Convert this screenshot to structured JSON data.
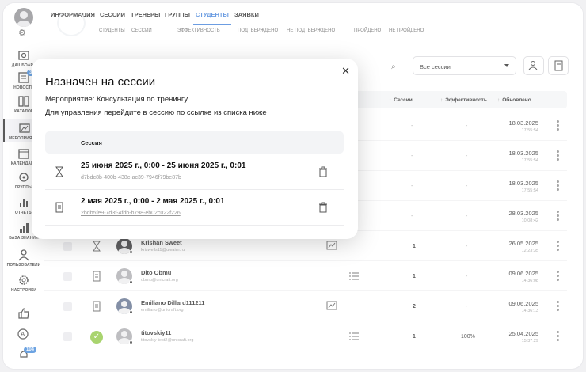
{
  "sidebar": {
    "items": [
      {
        "label": "ДАШБОАРД",
        "icon": "dashboard-icon"
      },
      {
        "label": "НОВОСТИ",
        "icon": "news-icon",
        "badge": "3"
      },
      {
        "label": "КАТАЛОГ",
        "icon": "catalog-icon"
      },
      {
        "label": "МЕРОПРИЯТИЯ",
        "icon": "events-icon"
      },
      {
        "label": "КАЛЕНДАРЬ",
        "icon": "calendar-icon"
      },
      {
        "label": "ГРУППЫ",
        "icon": "groups-icon"
      },
      {
        "label": "ОТЧЕТЫ",
        "icon": "reports-icon"
      },
      {
        "label": "БАЗА ЗНАНИЙ",
        "icon": "knowledge-base-icon"
      },
      {
        "label": "ПОЛЬЗОВАТЕЛИ",
        "icon": "users-icon"
      },
      {
        "label": "НАСТРОЙКИ",
        "icon": "settings-icon"
      }
    ],
    "bottom_badge": "104"
  },
  "topnav": {
    "tabs": [
      "ИНФОРМАЦИЯ",
      "СЕССИИ",
      "ТРЕНЕРЫ",
      "ГРУППЫ",
      "СТУДЕНТЫ",
      "ЗАЯВКИ"
    ],
    "active": "СТУДЕНТЫ"
  },
  "subheader": [
    "СТУДЕНТЫ",
    "СЕССИИ",
    "ЭФФЕКТИВНОСТЬ",
    "ПОДТВЕРЖДЕНО",
    "НЕ ПОДТВЕРЖДЕНО",
    "ПРОЙДЕНО",
    "НЕ ПРОЙДЕНО"
  ],
  "filters": {
    "select_value": "Все сессии"
  },
  "table": {
    "headers": {
      "sessions": "Сессии",
      "efficiency": "Эффективность",
      "updated": "Обновлено"
    },
    "rows": [
      {
        "name": "",
        "email": "",
        "sessions": "-",
        "efficiency": "-",
        "date": "18.03.2025",
        "time": "17:55:54"
      },
      {
        "name": "",
        "email": "",
        "sessions": "-",
        "efficiency": "-",
        "date": "18.03.2025",
        "time": "17:55:54"
      },
      {
        "name": "",
        "email": "",
        "sessions": "-",
        "efficiency": "-",
        "date": "18.03.2025",
        "time": "17:55:54"
      },
      {
        "name": "",
        "email": "",
        "sessions": "-",
        "efficiency": "-",
        "date": "28.03.2025",
        "time": "10:08:42"
      },
      {
        "name": "Krishan Sweet",
        "email": "kriswells11@uleairn.ru",
        "sessions": "1",
        "efficiency": "-",
        "date": "26.05.2025",
        "time": "12:23:35"
      },
      {
        "name": "Dito Obmu",
        "email": "obmu@unicraft.org",
        "sessions": "1",
        "efficiency": "-",
        "date": "09.06.2025",
        "time": "14:36:08"
      },
      {
        "name": "Emiliano Dillard111211",
        "email": "emiliano@unicraft.org",
        "sessions": "2",
        "efficiency": "-",
        "date": "09.06.2025",
        "time": "14:36:13"
      },
      {
        "name": "titovskiy11",
        "email": "titovskiy-test2@unicraft.org",
        "sessions": "1",
        "efficiency": "100%",
        "date": "25.04.2025",
        "time": "15:37:29"
      }
    ]
  },
  "modal": {
    "title": "Назначен на сессии",
    "event_line": "Мероприятие: Консультация по тренингу",
    "hint": "Для управления перейдите в сессию по ссылке из списка ниже",
    "column_header": "Сессия",
    "sessions": [
      {
        "title": "25 июня 2025 г., 0:00 - 25 июня 2025 г., 0:01",
        "id": "d7bdc8b-400b-438c-ac39-7946f79be87b"
      },
      {
        "title": "2 мая 2025 г., 0:00 - 2 мая 2025 г., 0:01",
        "id": "2bdb5fe9-7d3f-4fdb-b798-eb02c022f226"
      }
    ]
  }
}
